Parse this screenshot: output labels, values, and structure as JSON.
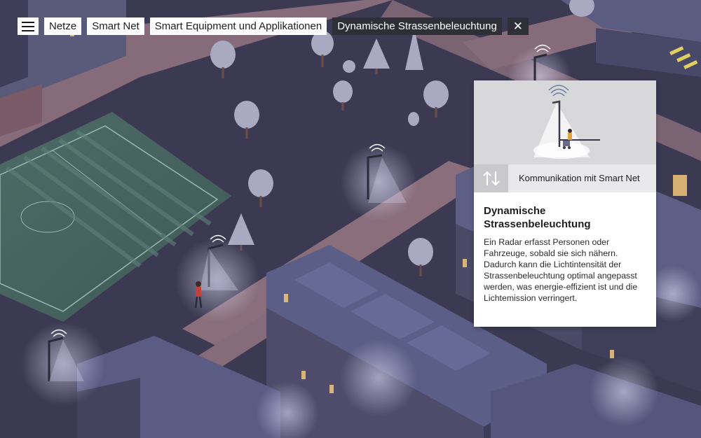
{
  "nav": {
    "menu_icon": "hamburger-menu-icon",
    "breadcrumbs": [
      {
        "label": "Netze"
      },
      {
        "label": "Smart Net"
      },
      {
        "label": "Smart Equipment und Applikationen"
      },
      {
        "label": "Dynamische Strassenbeleuchtung",
        "active": true
      }
    ],
    "close_icon": "close-icon",
    "close_glyph": "✕"
  },
  "card": {
    "communication_icon": "up-down-arrows-icon",
    "communication_label": "Kommunikation mit Smart Net",
    "title": "Dynamische Strassenbeleuchtung",
    "body": "Ein Radar erfasst Personen oder Fahrzeuge, sobald sie sich nähern. Dadurch kann die Lichtintensität der Strassenbeleuchtung optimal angepasst werden, was energie-effizient ist und die Lichtemission verringert."
  },
  "colors": {
    "scene_ground": "#3f3d57",
    "scene_path": "#8c6f7c",
    "building_roof": "#5b5e86",
    "light_glow": "#d8d6f0",
    "active_crumb": "#2f2f38"
  }
}
